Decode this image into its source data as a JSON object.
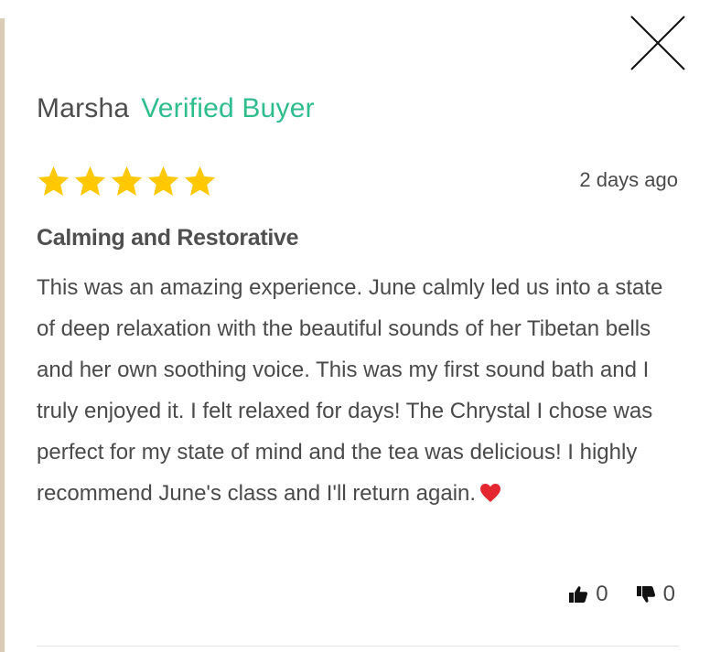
{
  "review": {
    "reviewer_name": "Marsha",
    "verified_label": "Verified Buyer",
    "rating": 5,
    "rating_max": 5,
    "date": "2 days ago",
    "title": "Calming and Restorative",
    "body": "This was an amazing experience. June calmly led us into a state of deep relaxation with the beautiful sounds of her Tibetan bells and her own soothing voice. This was my first sound bath and I truly enjoyed it. I felt relaxed for days! The Chrystal I chose was perfect for my state of mind and the tea was delicious! I highly recommend June's class and I'll return again.",
    "body_emoji": "heart-icon",
    "thumbs_up_count": "0",
    "thumbs_down_count": "0"
  },
  "icons": {
    "close": "close-icon",
    "star": "star-icon",
    "thumbs_up": "thumbs-up-icon",
    "thumbs_down": "thumbs-down-icon"
  },
  "colors": {
    "verified": "#2fbd8c",
    "star": "#ffc800",
    "heart": "#e3262f",
    "text": "#4a4a4a",
    "left_edge": "#d9cbb5"
  }
}
